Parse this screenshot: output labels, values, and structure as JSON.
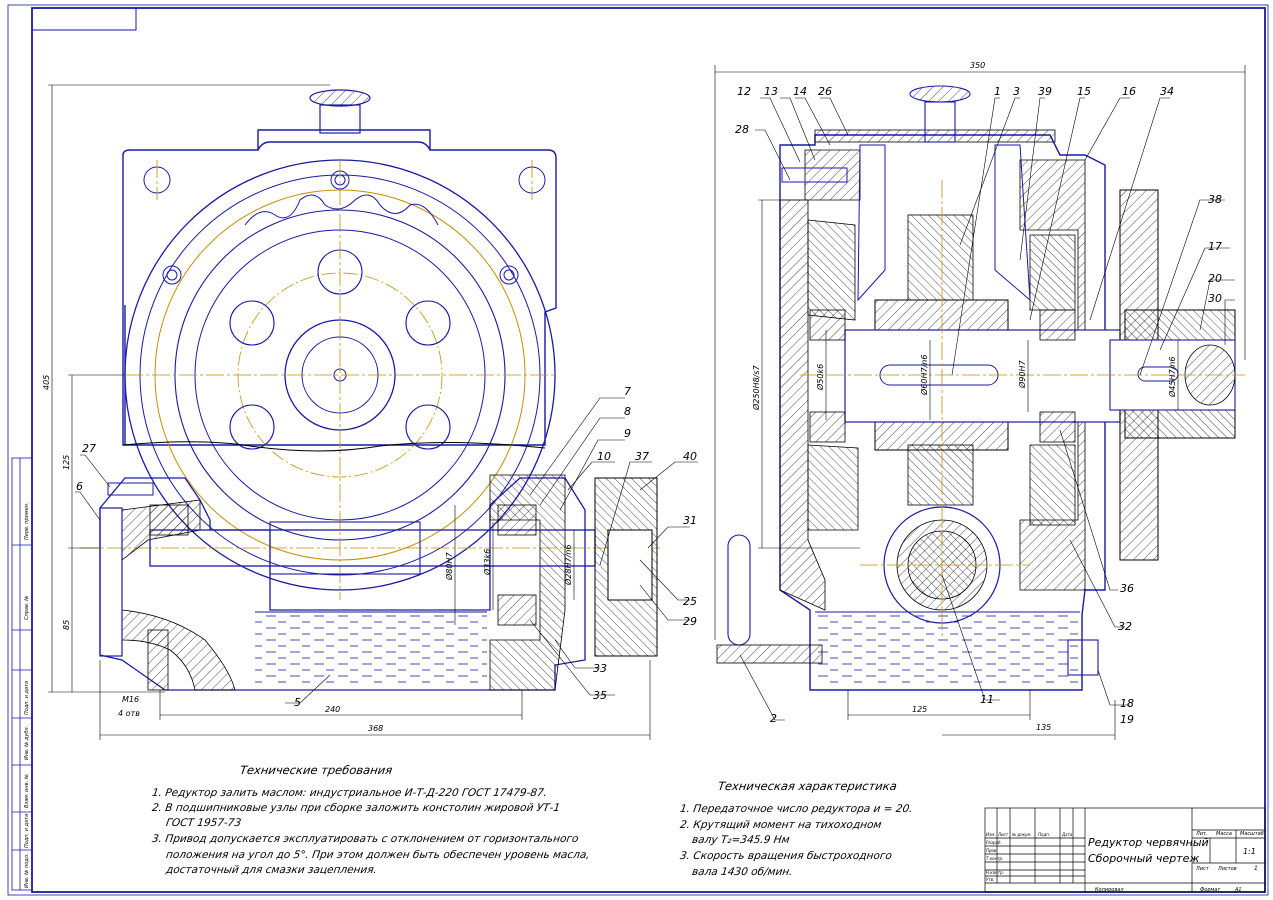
{
  "colors": {
    "contour": "#1a1aa6",
    "axis": "#c89000",
    "hatch": "#000000",
    "oil": "#1a1aa6",
    "frame": "#1a1aa6"
  },
  "callouts_left": [
    "7",
    "8",
    "9",
    "10",
    "37",
    "40",
    "27",
    "6",
    "31",
    "25",
    "29",
    "33",
    "35",
    "5"
  ],
  "callouts_right": [
    "12",
    "13",
    "14",
    "26",
    "1",
    "3",
    "39",
    "15",
    "16",
    "34",
    "28",
    "38",
    "17",
    "20",
    "30",
    "36",
    "32",
    "11",
    "2",
    "18",
    "19"
  ],
  "dims_left": {
    "overall_height": "405",
    "upper": "125",
    "lower": "85",
    "shaft_dia_1": "Ø80H7",
    "shaft_dia_2": "Ø33k6",
    "shaft_dia_3": "Ø28H7/n6",
    "thread": "M16",
    "holes": "4 отв",
    "base_width": "240",
    "overall_width": "368"
  },
  "dims_right": {
    "overall_width": "350",
    "housing_dia": "Ø250H8/s7",
    "bearing_dia": "Ø50k6",
    "wheel_dia": "Ø60H7/n6",
    "hub_dia": "Ø90H7",
    "sprocket_dia": "Ø45H7/n6",
    "axis_distance": "125",
    "right_offset": "135"
  },
  "requirements": {
    "title": "Технические требования",
    "items": [
      "1. Редуктор залить маслом: индустриальное И-Т-Д-220 ГОСТ 17479-87.",
      "2. В подшипниковые узлы при сборке заложить констолин жировой УТ-1",
      "ГОСТ 1957-73",
      "3. Привод допускается эксплуатировать с отклонением от горизонтального",
      "положения на угол до 5°. При этом должен быть обеспечен уровень масла,",
      "достаточный для смазки зацепления."
    ]
  },
  "characteristics": {
    "title": "Техническая характеристика",
    "items": [
      "1. Передаточное число редуктора и = 20.",
      "2. Крутящий момент на тихоходном",
      "валу T₂=345.9 Нм",
      "3. Скорость вращения быстроходного",
      "вала 1430 об/мин."
    ]
  },
  "title_block": {
    "name_line1": "Редуктор червячный",
    "name_line2": "Сборочный чертеж",
    "lit_label": "Лит.",
    "mass_label": "Масса",
    "scale_label": "Масштаб",
    "scale": "1:1",
    "sheet_label": "Лист",
    "sheets_label": "Листов",
    "sheets": "1",
    "copied_label": "Копировал",
    "format_label": "Формат",
    "format": "А1",
    "row_labels": [
      "Изм.",
      "Лист",
      "№ докум.",
      "Подп.",
      "Дата"
    ],
    "role_labels": [
      "Разраб.",
      "Пров.",
      "Т.контр.",
      "",
      "Н.контр.",
      "Утв."
    ]
  },
  "side_labels": [
    "Перв. примен.",
    "Справ. №",
    "Подп. и дата",
    "Инв. № дубл.",
    "Взам. инв. №",
    "Подп. и дата",
    "Инв. № подл."
  ]
}
